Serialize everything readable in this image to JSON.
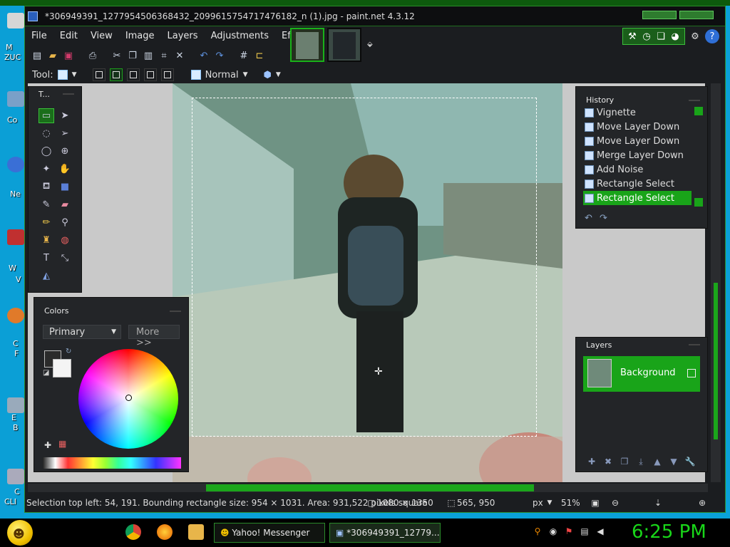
{
  "window": {
    "title": "*306949391_1277954506368432_2099615754717476182_n (1).jpg - paint.net 4.3.12"
  },
  "desktop_labels": [
    "M",
    "ZUC",
    "Co",
    "Ne",
    "W",
    "V",
    "C",
    "F",
    "E",
    "B",
    "C",
    "CLI"
  ],
  "menu": [
    "File",
    "Edit",
    "View",
    "Image",
    "Layers",
    "Adjustments",
    "Effects"
  ],
  "toolbar2": {
    "tool_label": "Tool:",
    "blend_mode": "Normal"
  },
  "panels": {
    "tools_title": "T...",
    "colors_title": "Colors",
    "history_title": "History",
    "layers_title": "Layers"
  },
  "colors": {
    "primary_select": "Primary",
    "more_button": "More >>",
    "primary_color": "#2b2b2b",
    "secondary_color": "#f4f4f4"
  },
  "history": {
    "items": [
      {
        "label": "Vignette"
      },
      {
        "label": "Move Layer Down"
      },
      {
        "label": "Move Layer Down"
      },
      {
        "label": "Merge Layer Down"
      },
      {
        "label": "Add Noise"
      },
      {
        "label": "Rectangle Select"
      },
      {
        "label": "Rectangle Select"
      }
    ]
  },
  "layers": {
    "items": [
      {
        "name": "Background"
      }
    ]
  },
  "status": {
    "selection": "Selection top left: 54, 191. Bounding rectangle size: 954 × 1031. Area: 931,522 pixels square",
    "image_size": "1080 × 1350",
    "cursor_pos": "565, 950",
    "unit": "px",
    "zoom": "51%"
  },
  "taskbar": {
    "yahoo": "Yahoo! Messenger",
    "paintnet": "*306949391_12779..."
  },
  "clock": "6:25 PM",
  "accent_color": "#19a419"
}
